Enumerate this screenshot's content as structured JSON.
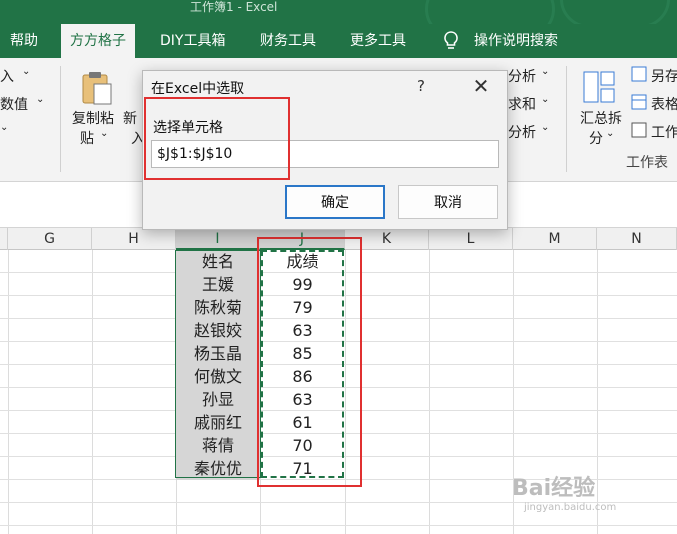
{
  "window": {
    "title": "工作簿1  -  Excel"
  },
  "tabs": [
    "帮助",
    "方方格子",
    "DIY工具箱",
    "财务工具",
    "更多工具",
    "操作说明搜索"
  ],
  "ribbon": {
    "left_partial": [
      "入",
      "数值",
      "·"
    ],
    "copy_paste": [
      "复制粘",
      "贴"
    ],
    "new_partial": [
      "新",
      "入"
    ],
    "analyze_items": [
      "分析",
      "求和",
      "分析"
    ],
    "summary": [
      "汇总拆",
      "分"
    ],
    "worksheet_items": [
      "另存",
      "表格",
      "工作"
    ],
    "group_label": "工作表"
  },
  "columns": [
    "G",
    "H",
    "I",
    "J",
    "K",
    "L",
    "M",
    "N"
  ],
  "table": {
    "header": {
      "name": "姓名",
      "score": "成绩"
    },
    "rows": [
      {
        "name": "王媛",
        "score": "99"
      },
      {
        "name": "陈秋菊",
        "score": "79"
      },
      {
        "name": "赵银姣",
        "score": "63"
      },
      {
        "name": "杨玉晶",
        "score": "85"
      },
      {
        "name": "何傲文",
        "score": "86"
      },
      {
        "name": "孙显",
        "score": "63"
      },
      {
        "name": "戚丽红",
        "score": "61"
      },
      {
        "name": "蒋倩",
        "score": "70"
      },
      {
        "name": "秦优优",
        "score": "71"
      }
    ]
  },
  "dialog": {
    "title": "在Excel中选取",
    "help": "?",
    "close": "✕",
    "label": "选择单元格",
    "value": "$J$1:$J$10",
    "ok": "确定",
    "cancel": "取消"
  },
  "watermark": {
    "logo": "Bai经验",
    "url": "jingyan.baidu.com"
  },
  "colors": {
    "excel_green": "#217346",
    "highlight_red": "#e03030",
    "ok_border": "#2b77c8"
  }
}
